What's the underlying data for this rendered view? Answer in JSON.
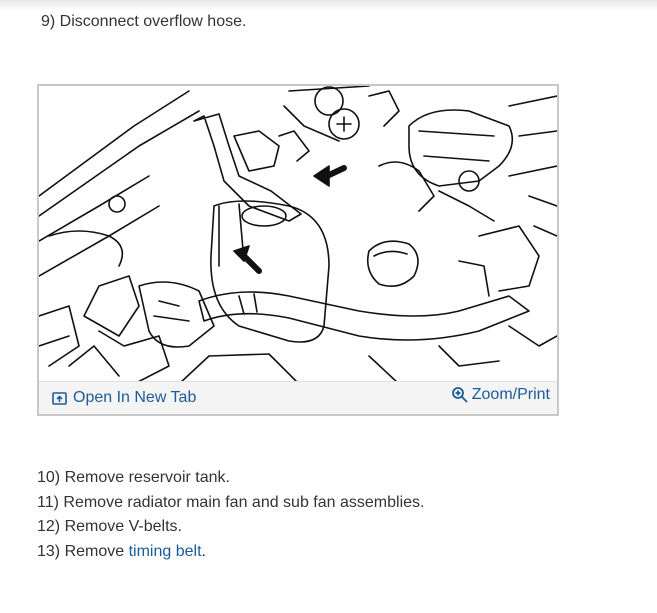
{
  "intro_step": "9) Disconnect overflow hose.",
  "figure": {
    "open_tab_label": "Open In New Tab",
    "zoom_label": "Zoom/Print",
    "open_icon": "open-in-new-tab-icon",
    "zoom_icon": "magnifier-plus-icon"
  },
  "steps": [
    {
      "text": "10) Remove reservoir tank."
    },
    {
      "text": "11) Remove radiator main fan and sub fan assemblies."
    },
    {
      "text": "12) Remove V-belts."
    },
    {
      "text": "13) Remove ",
      "link": "timing belt",
      "suffix": "."
    }
  ],
  "colors": {
    "link": "#1a5c99",
    "text": "#333333",
    "border": "#c8c8c8"
  }
}
